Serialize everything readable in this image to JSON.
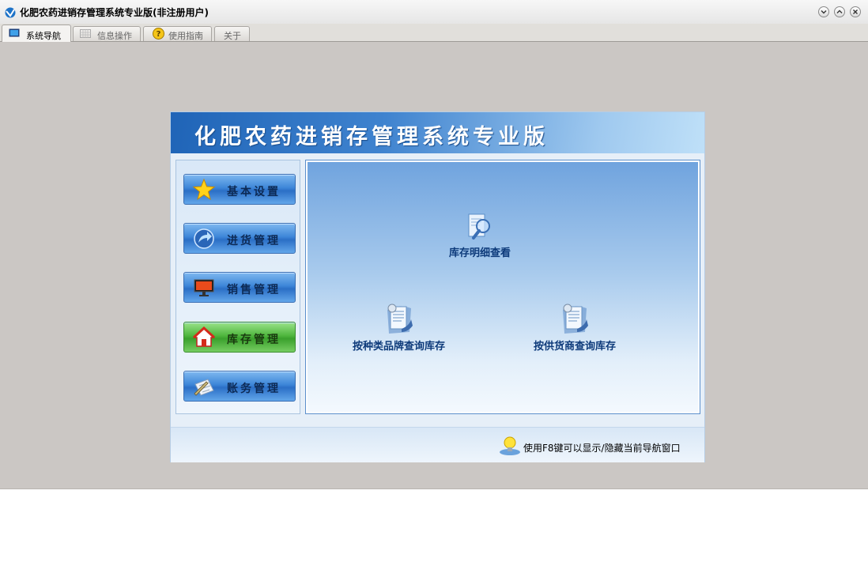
{
  "window": {
    "title": "化肥农药进销存管理系统专业版(非注册用户)"
  },
  "tabs": [
    {
      "label": "系统导航",
      "active": true,
      "icon": "monitor-icon"
    },
    {
      "label": "信息操作",
      "active": false,
      "icon": "grid-icon"
    },
    {
      "label": "使用指南",
      "active": false,
      "icon": "help-icon"
    },
    {
      "label": "关于",
      "active": false
    }
  ],
  "panel": {
    "banner_title": "化肥农药进销存管理系统专业版",
    "nav": [
      {
        "label": "基本设置",
        "icon": "star-icon",
        "active": false
      },
      {
        "label": "进货管理",
        "icon": "arrow-icon",
        "active": false
      },
      {
        "label": "销售管理",
        "icon": "monitor-icon",
        "active": false
      },
      {
        "label": "库存管理",
        "icon": "home-icon",
        "active": true
      },
      {
        "label": "账务管理",
        "icon": "pen-paper-icon",
        "active": false
      }
    ],
    "functions": [
      {
        "label": "库存明细查看",
        "icon": "magnifier-icon"
      },
      {
        "label": "按种类品牌查询库存",
        "icon": "document-icon"
      },
      {
        "label": "按供货商查询库存",
        "icon": "document-icon"
      }
    ],
    "hint": "使用F8键可以显示/隐藏当前导航窗口"
  },
  "colors": {
    "window_bg": "#cbc7c4",
    "banner": "#1f64b7",
    "active_nav": "#4fb63e",
    "nav": "#3d86d8"
  }
}
